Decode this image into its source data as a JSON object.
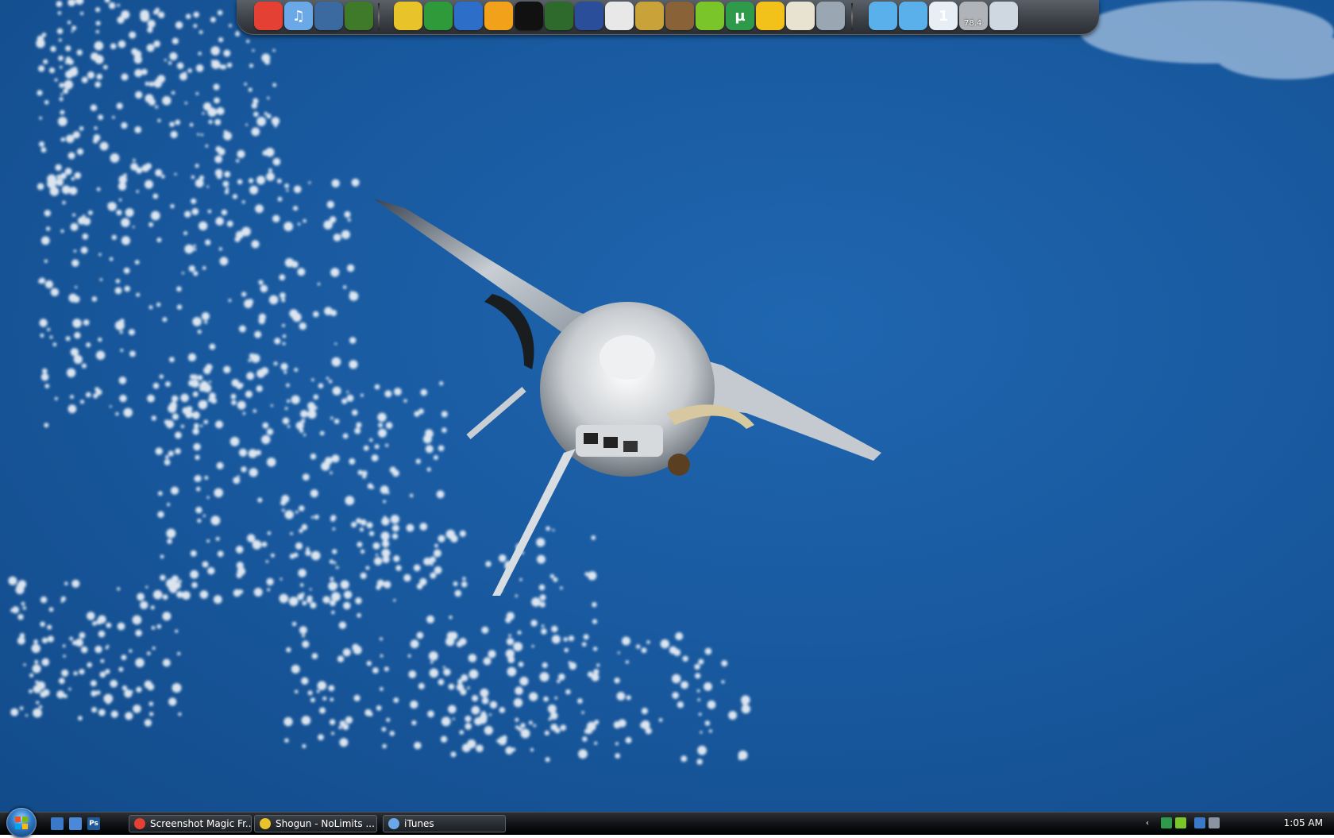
{
  "desktop": {
    "wallpaper": "space-shuttle-over-ocean",
    "background_color": "#1a5aa0"
  },
  "dock": {
    "icons": [
      {
        "name": "chrome-icon",
        "glyph": "",
        "color": "#e44134"
      },
      {
        "name": "itunes-icon",
        "glyph": "♫",
        "color": "#6aa8e8"
      },
      {
        "name": "monitor-icon",
        "glyph": "",
        "color": "#3a6aa0"
      },
      {
        "name": "tree-icon",
        "glyph": "",
        "color": "#3f7a2b"
      },
      {
        "name": "shogun-app-icon",
        "glyph": "",
        "color": "#e8c32a"
      },
      {
        "name": "landscape-icon",
        "glyph": "",
        "color": "#2f9a3a"
      },
      {
        "name": "spiral-icon",
        "glyph": "",
        "color": "#2d6fc8"
      },
      {
        "name": "fl-studio-icon",
        "glyph": "",
        "color": "#f2a21a"
      },
      {
        "name": "steam-icon",
        "glyph": "",
        "color": "#111111"
      },
      {
        "name": "alien-icon",
        "glyph": "",
        "color": "#2e6a2b"
      },
      {
        "name": "google-earth-icon",
        "glyph": "",
        "color": "#2a4e9a"
      },
      {
        "name": "panda-icon",
        "glyph": "",
        "color": "#e8e8e8"
      },
      {
        "name": "golden-symbol-icon",
        "glyph": "",
        "color": "#caa23a"
      },
      {
        "name": "guitar-icon",
        "glyph": "",
        "color": "#8a6238"
      },
      {
        "name": "limewire-icon",
        "glyph": "",
        "color": "#7ac62a"
      },
      {
        "name": "utorrent-icon",
        "glyph": "µ",
        "color": "#2f9a4a"
      },
      {
        "name": "activity-monitor-icon",
        "glyph": "",
        "color": "#f2c21a"
      },
      {
        "name": "notepad-icon",
        "glyph": "",
        "color": "#e8e2d0"
      },
      {
        "name": "network-computers-icon",
        "glyph": "",
        "color": "#9aa6b2"
      }
    ],
    "widgets": [
      {
        "name": "magnet-icon",
        "glyph": "",
        "color": "#5ab0ea"
      },
      {
        "name": "magnet-settings-icon",
        "glyph": "",
        "color": "#5ab0ea"
      },
      {
        "name": "calendar-icon",
        "glyph": "1",
        "color": "#e8eef5"
      },
      {
        "name": "weather-moon-icon",
        "glyph": "",
        "color": "#b0b4b8"
      },
      {
        "name": "recycle-bin-icon",
        "glyph": "",
        "color": "#cfd8e0"
      }
    ],
    "weather_temp": "78.4"
  },
  "taskbar": {
    "quick_launch": [
      {
        "name": "show-desktop-icon",
        "glyph": "",
        "color": "#3a78c8"
      },
      {
        "name": "switch-windows-icon",
        "glyph": "",
        "color": "#4a88d8"
      },
      {
        "name": "photoshop-icon",
        "glyph": "Ps",
        "color": "#1e5a9a"
      }
    ],
    "tasks": [
      {
        "name": "task-screenshot-magic",
        "label": "Screenshot Magic Fr...",
        "icon_color": "#e44134"
      },
      {
        "name": "task-shogun",
        "label": "Shogun - NoLimits ...",
        "icon_color": "#e8c32a"
      },
      {
        "name": "task-itunes",
        "label": "iTunes",
        "icon_color": "#6aa8e8"
      }
    ],
    "tray": {
      "show_hidden_glyph": "‹",
      "clock": "1:05 AM"
    }
  }
}
